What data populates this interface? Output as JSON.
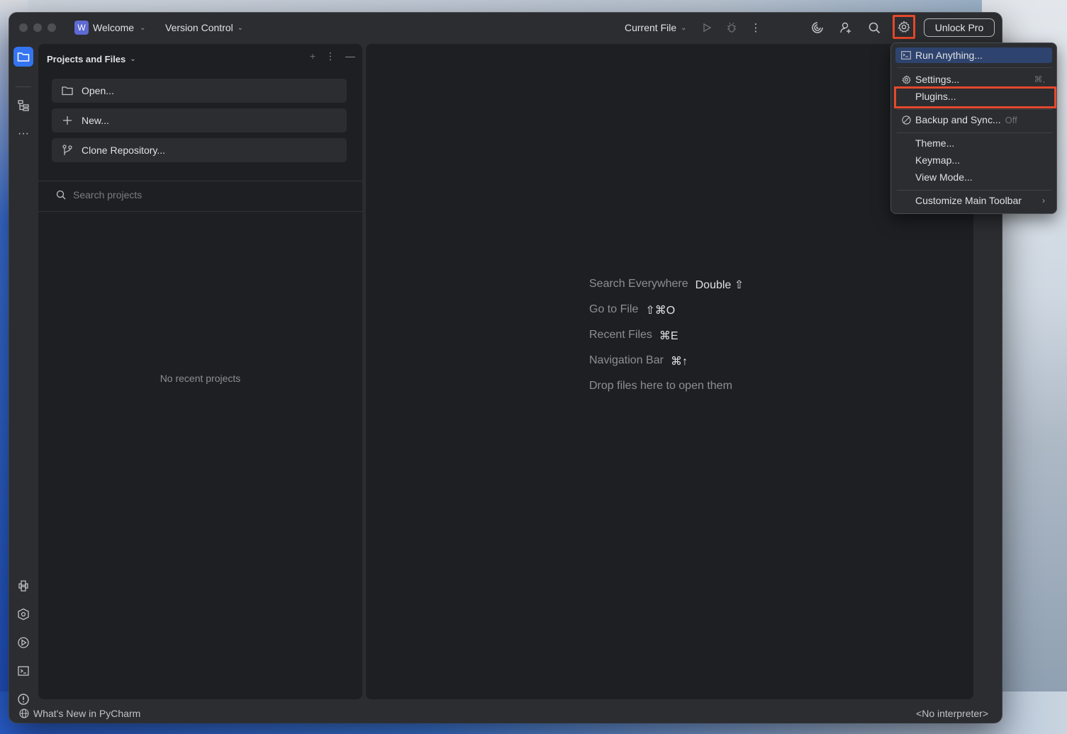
{
  "titlebar": {
    "project_badge": "W",
    "project_name": "Welcome",
    "vcs_label": "Version Control",
    "run_config": "Current File",
    "unlock_label": "Unlock Pro"
  },
  "sidebar_panel": {
    "title": "Projects and Files",
    "actions": [
      {
        "label": "Open...",
        "icon": "folder-icon"
      },
      {
        "label": "New...",
        "icon": "plus-icon"
      },
      {
        "label": "Clone Repository...",
        "icon": "branch-icon"
      }
    ],
    "search_placeholder": "Search projects",
    "empty_text": "No recent projects"
  },
  "editor_hints": [
    {
      "label": "Search Everywhere",
      "key": "Double ⇧"
    },
    {
      "label": "Go to File",
      "key": "⇧⌘O"
    },
    {
      "label": "Recent Files",
      "key": "⌘E"
    },
    {
      "label": "Navigation Bar",
      "key": "⌘↑"
    },
    {
      "label": "Drop files here to open them",
      "key": ""
    }
  ],
  "status": {
    "whats_new": "What's New in PyCharm",
    "interpreter": "<No interpreter>"
  },
  "settings_menu": {
    "items": [
      {
        "label": "Run Anything...",
        "icon": "run-anything-icon",
        "shortcut": "",
        "selected": true
      },
      {
        "label": "Settings...",
        "icon": "gear-icon",
        "shortcut": "⌘,"
      },
      {
        "label": "Plugins...",
        "icon": "",
        "shortcut": ""
      },
      {
        "label": "Backup and Sync...",
        "icon": "disabled-icon",
        "extra": "Off"
      },
      {
        "label": "Theme...",
        "icon": ""
      },
      {
        "label": "Keymap...",
        "icon": ""
      },
      {
        "label": "View Mode...",
        "icon": ""
      },
      {
        "label": "Customize Main Toolbar",
        "icon": "",
        "submenu": "›"
      }
    ]
  },
  "colors": {
    "accent": "#3574f0",
    "highlight": "#e5482b",
    "window_bg": "#2b2d30",
    "editor_bg": "#1e1f22"
  }
}
